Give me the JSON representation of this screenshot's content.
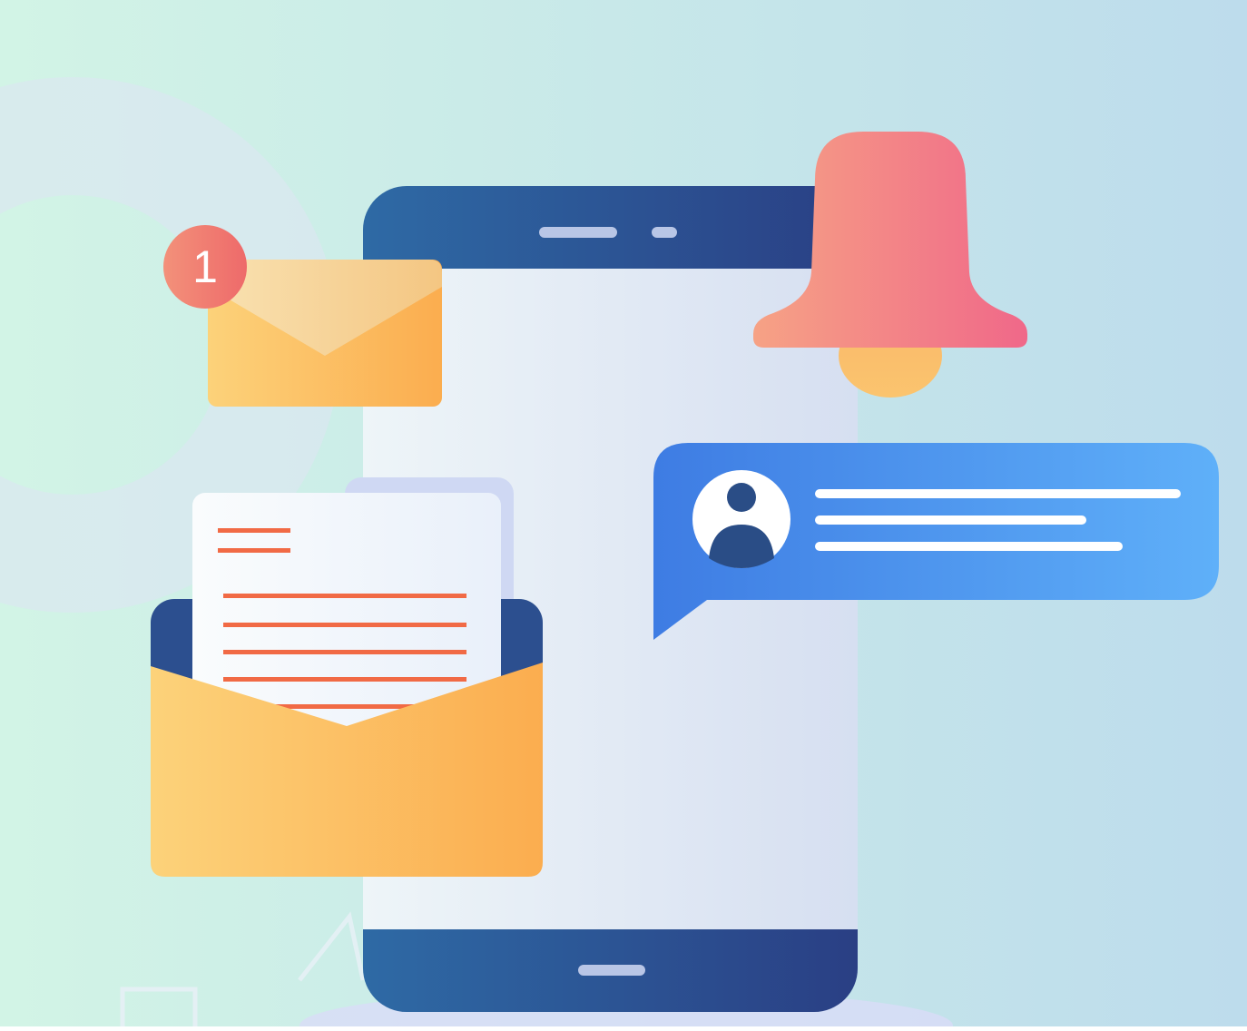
{
  "notification_badge": {
    "count": "1"
  },
  "colors": {
    "background_left": "#d2f4e6",
    "background_right": "#bddcec",
    "phone_dark": "#2a3f84",
    "phone_mid": "#2e6aa5",
    "phone_screen": "#e7eef8",
    "envelope_light": "#fcd27a",
    "envelope_dark": "#fbad4f",
    "badge": "#f07a6d",
    "bell_light": "#f6a285",
    "bell_dark": "#f06889",
    "chat_bubble_dark": "#3e7ce3",
    "chat_bubble_light": "#5fb0f9",
    "document_lines": "#f16a45"
  },
  "icons": [
    "smartphone-icon",
    "envelope-icon",
    "notification-badge-icon",
    "bell-icon",
    "chat-bubble-icon",
    "user-avatar-icon",
    "open-envelope-icon",
    "document-icon"
  ]
}
